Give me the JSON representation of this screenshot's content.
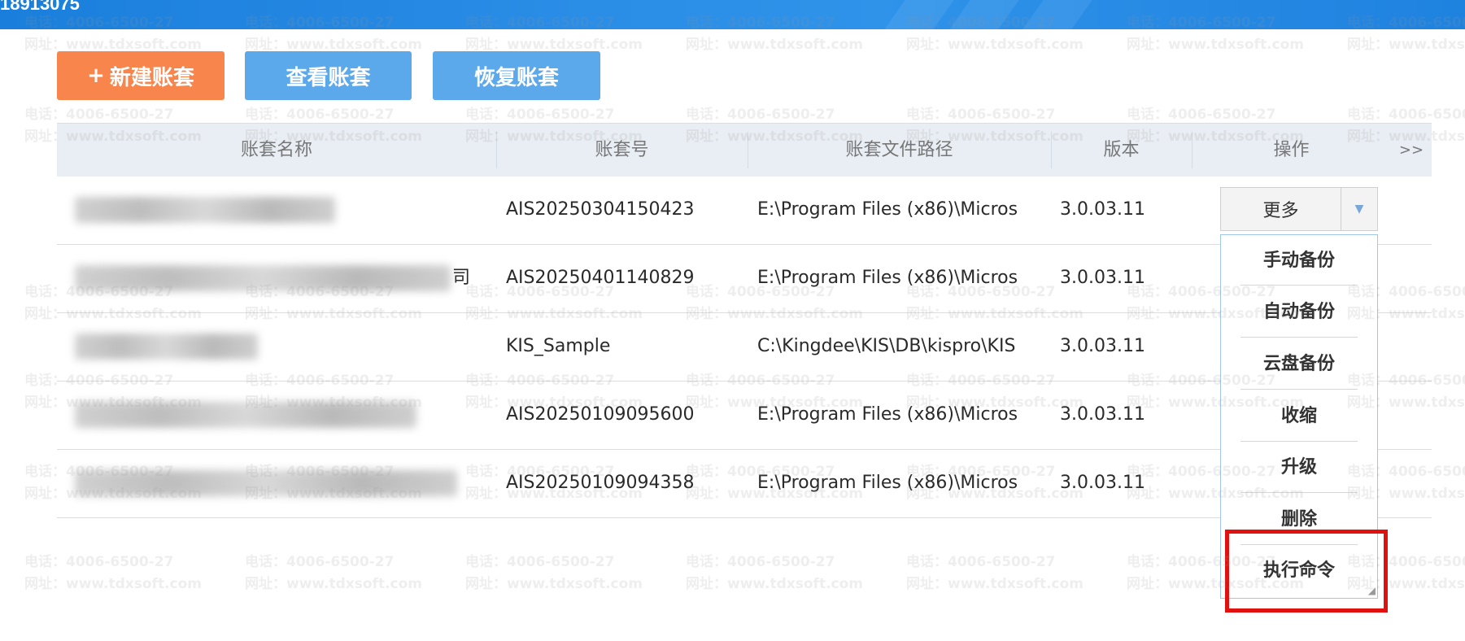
{
  "window": {
    "title": "18913075"
  },
  "watermark": {
    "phone": "电话：4006-6500-27",
    "site": "网址：www.tdxsoft.com"
  },
  "toolbar": {
    "new_label": "新建账套",
    "new_icon": "plus-icon",
    "view_label": "查看账套",
    "restore_label": "恢复账套"
  },
  "table": {
    "columns": [
      "账套名称",
      "账套号",
      "账套文件路径",
      "版本",
      "操作"
    ],
    "more_columns": ">>",
    "rows": [
      {
        "name_suffix": "",
        "id": "AIS20250304150423",
        "path": "E:\\Program Files (x86)\\Micros",
        "version": "3.0.03.11"
      },
      {
        "name_suffix": "司",
        "id": "AIS20250401140829",
        "path": "E:\\Program Files (x86)\\Micros",
        "version": "3.0.03.11"
      },
      {
        "name_suffix": "",
        "id": "KIS_Sample",
        "path": "C:\\Kingdee\\KIS\\DB\\kispro\\KIS",
        "version": "3.0.03.11"
      },
      {
        "name_suffix": "",
        "id": "AIS20250109095600",
        "path": "E:\\Program Files (x86)\\Micros",
        "version": "3.0.03.11"
      },
      {
        "name_suffix": "",
        "id": "AIS20250109094358",
        "path": "E:\\Program Files (x86)\\Micros",
        "version": "3.0.03.11"
      }
    ]
  },
  "action": {
    "more_label": "更多"
  },
  "menu": {
    "items": [
      "手动备份",
      "自动备份",
      "云盘备份",
      "收缩",
      "升级",
      "删除",
      "执行命令"
    ]
  },
  "colors": {
    "titlebar": "#1a7fdc",
    "primary_button": "#5ba8ea",
    "new_button": "#f7854c",
    "highlight": "#e0110e"
  }
}
